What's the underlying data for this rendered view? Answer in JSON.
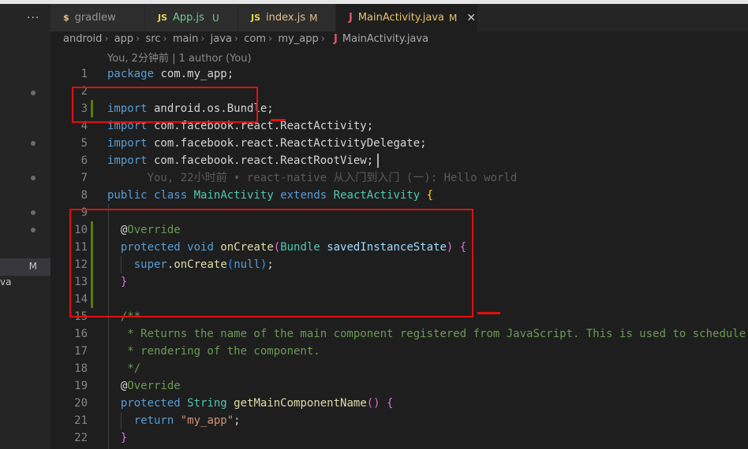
{
  "tabs": [
    {
      "icon": "$",
      "label": "gradlew",
      "status": ""
    },
    {
      "icon": "JS",
      "label": "App.js",
      "status": "U"
    },
    {
      "icon": "JS",
      "label": "index.js",
      "status": "M"
    },
    {
      "icon": "J",
      "label": "MainActivity.java",
      "status": "M"
    }
  ],
  "breadcrumb": [
    "android",
    "app",
    "src",
    "main",
    "java",
    "com",
    "my_app",
    "MainActivity.java"
  ],
  "codelens": "You, 2分钟前 | 1 author (You)",
  "sidebar": {
    "more": "···",
    "badge": "M",
    "partial_label": "va"
  },
  "lines": {
    "n": [
      "1",
      "2",
      "3",
      "4",
      "5",
      "6",
      "7",
      "8",
      "9",
      "10",
      "11",
      "12",
      "13",
      "14",
      "15",
      "16",
      "17",
      "18",
      "19",
      "20",
      "21",
      "22"
    ],
    "l1": {
      "kw": "package",
      "rest": " com.my_app;"
    },
    "l3": {
      "kw": "import",
      "rest": " android.os.Bundle;"
    },
    "l4": {
      "kw": "import",
      "rest": " com.facebook.react.ReactActivity;"
    },
    "l5": {
      "kw": "import",
      "rest": " com.facebook.react.ReactActivityDelegate;"
    },
    "l6": {
      "kw": "import",
      "rest": " com.facebook.react.ReactRootView;"
    },
    "l7": {
      "blame": "      You, 22小时前 • react-native 从入门到入门 (一): Hello world"
    },
    "l8": {
      "kw1": "public",
      "kw2": "class",
      "cls": "MainActivity",
      "kw3": "extends",
      "base": "ReactActivity",
      "brace": "{"
    },
    "l10": {
      "at": "@",
      "ann": "Override"
    },
    "l11": {
      "kw1": "protected",
      "kw2": "void",
      "fn": "onCreate",
      "p1": "(",
      "ty": "Bundle",
      "var": "savedInstanceState",
      "p2": ")",
      "brace": "{"
    },
    "l12": {
      "kw": "super",
      "dot": ".",
      "fn": "onCreate",
      "p1": "(",
      "nul": "null",
      "p2": ")",
      "semi": ";"
    },
    "l13": {
      "brace": "}"
    },
    "l15": {
      "com": "/**"
    },
    "l16": {
      "com": " * Returns the name of the main component registered from JavaScript. This is used to schedule"
    },
    "l17": {
      "com": " * rendering of the component."
    },
    "l18": {
      "com": " */"
    },
    "l19": {
      "at": "@",
      "ann": "Override"
    },
    "l20": {
      "kw": "protected",
      "ty": "String",
      "fn": "getMainComponentName",
      "parens": "()",
      "brace": "{"
    },
    "l21": {
      "kw": "return",
      "str": "\"my_app\"",
      "semi": ";"
    },
    "l22": {
      "brace": "}"
    }
  }
}
